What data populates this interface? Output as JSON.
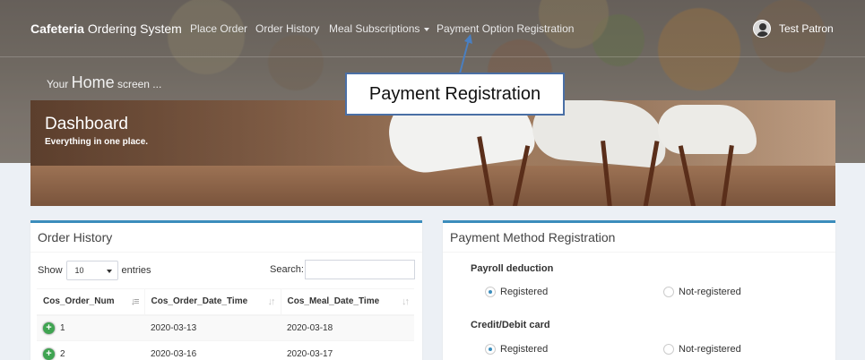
{
  "navbar": {
    "brand_bold": "Cafeteria",
    "brand_rest": "Ordering System",
    "items": [
      {
        "label": "Place Order"
      },
      {
        "label": "Order History"
      },
      {
        "label": "Meal Subscriptions"
      },
      {
        "label": "Payment Option Registration"
      }
    ],
    "user_name": "Test Patron"
  },
  "home_line": {
    "prefix": "Your",
    "home": "Home",
    "suffix": "screen ..."
  },
  "annotation": {
    "label": "Payment Registration"
  },
  "dashboard": {
    "title": "Dashboard",
    "subtitle": "Everything in one place."
  },
  "order_history": {
    "title": "Order History",
    "show_label": "Show",
    "entries_value": "10",
    "entries_label": "entries",
    "search_label": "Search:",
    "search_value": "",
    "columns": [
      "Cos_Order_Num",
      "Cos_Order_Date_Time",
      "Cos_Meal_Date_Time"
    ],
    "rows": [
      {
        "num": "1",
        "order_date": "2020-03-13",
        "meal_date": "2020-03-18"
      },
      {
        "num": "2",
        "order_date": "2020-03-16",
        "meal_date": "2020-03-17"
      }
    ]
  },
  "payment": {
    "title": "Payment Method Registration",
    "options": [
      {
        "label": "Payroll deduction",
        "registered": "Registered",
        "not_registered": "Not-registered"
      },
      {
        "label": "Credit/Debit card",
        "registered": "Registered",
        "not_registered": "Not-registered"
      }
    ]
  },
  "colors": {
    "accent": "#3c8dbc",
    "annotation_border": "#4a6fa5",
    "expand_button": "#3fa451"
  }
}
